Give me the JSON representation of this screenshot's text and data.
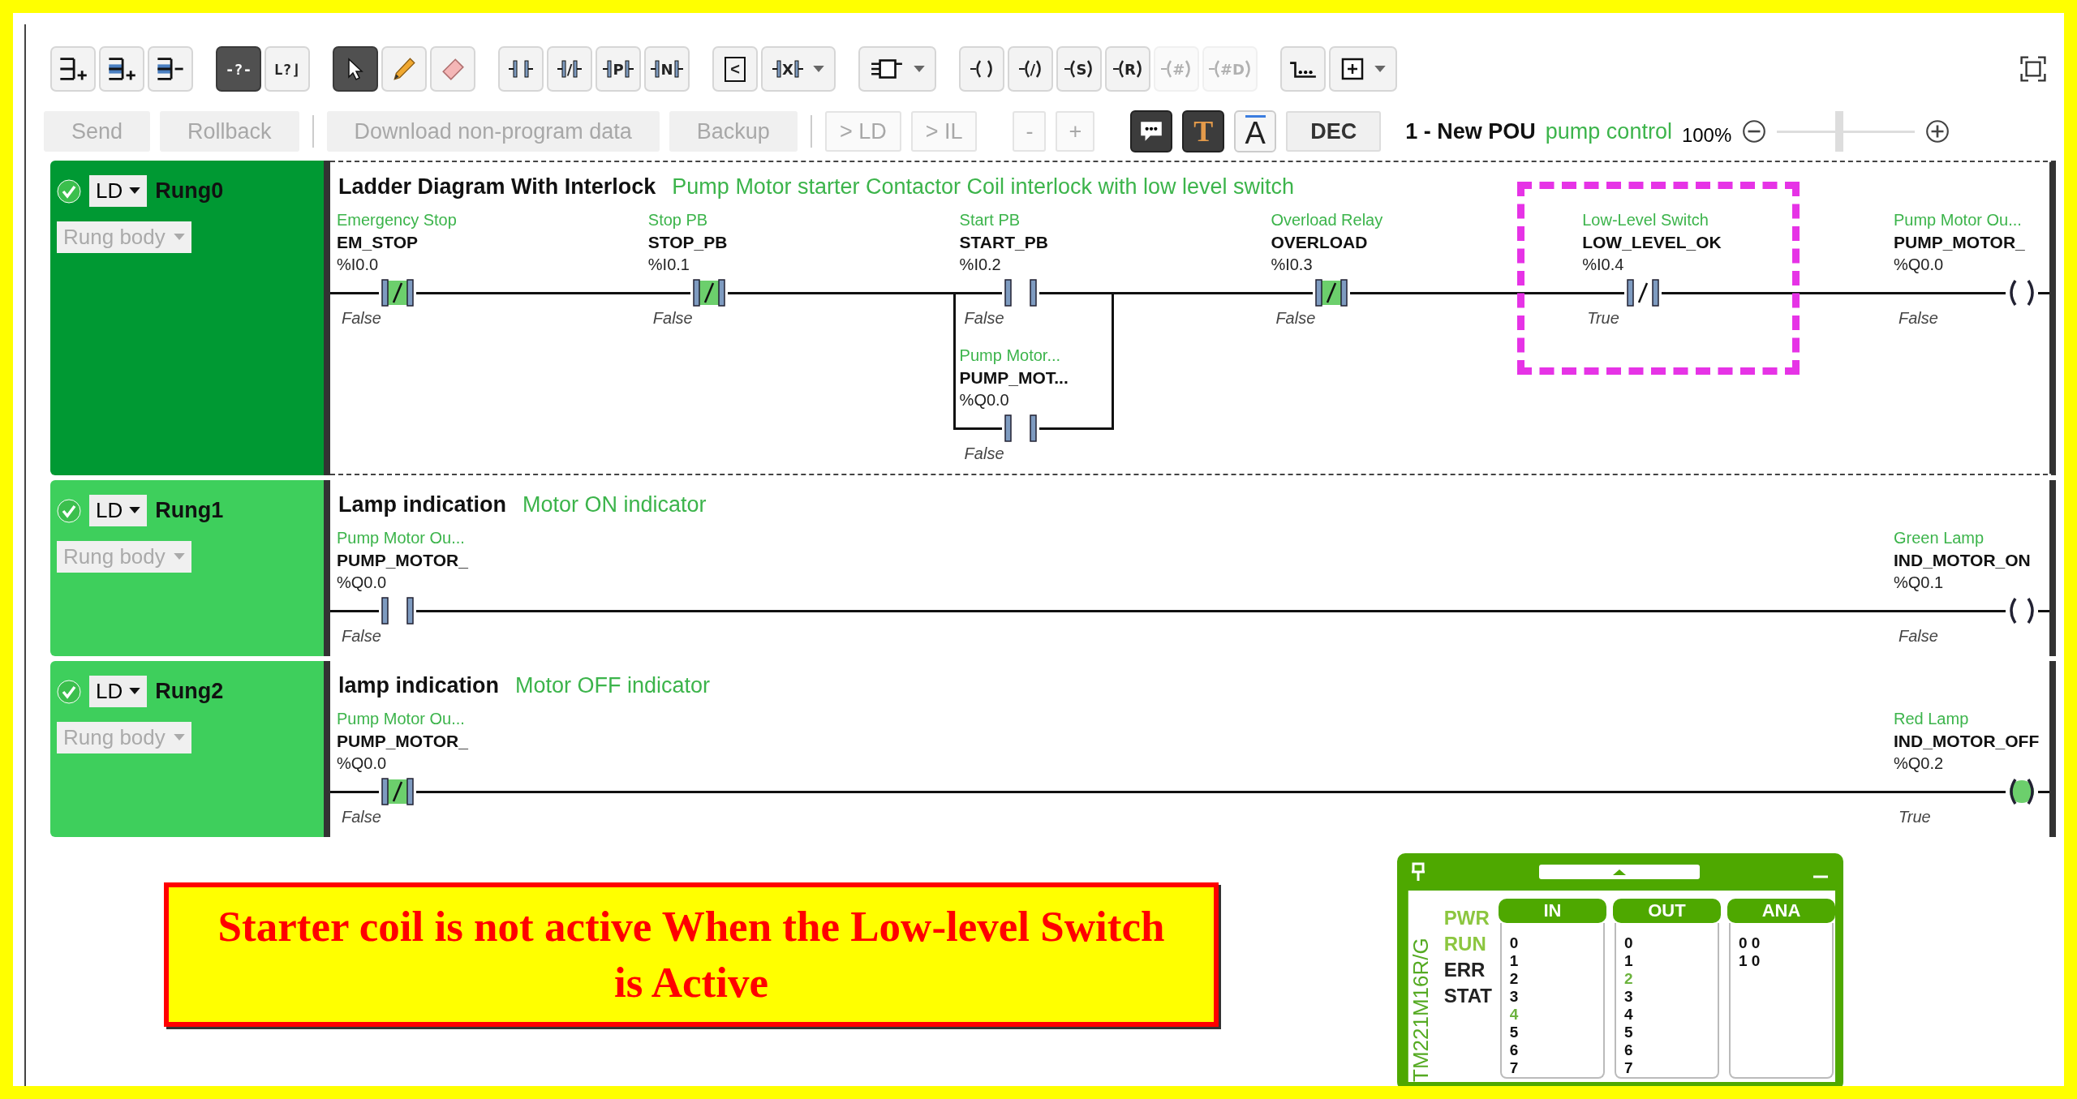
{
  "toolbar": [
    {
      "kind": "rung_add",
      "selected": false,
      "disabled": false,
      "dropdown": false
    },
    {
      "kind": "rung_add_blue",
      "selected": false,
      "disabled": false,
      "dropdown": false
    },
    {
      "kind": "rung_remove",
      "selected": false,
      "disabled": false,
      "dropdown": false
    },
    {
      "kind": "glyph",
      "glyph": "-?-",
      "selected": true,
      "disabled": false,
      "dropdown": false
    },
    {
      "kind": "glyph",
      "glyph": "L?⌋",
      "selected": false,
      "disabled": false,
      "dropdown": false
    },
    {
      "kind": "pointer",
      "selected": true,
      "disabled": false,
      "dropdown": false
    },
    {
      "kind": "pencil",
      "selected": false,
      "disabled": false,
      "dropdown": false
    },
    {
      "kind": "eraser",
      "selected": false,
      "disabled": false,
      "dropdown": false
    },
    {
      "kind": "contact",
      "selected": false,
      "disabled": false,
      "dropdown": false
    },
    {
      "kind": "contact",
      "glyph": "/",
      "selected": false,
      "disabled": false,
      "dropdown": false
    },
    {
      "kind": "contact",
      "glyph": "P",
      "selected": false,
      "disabled": false,
      "dropdown": false
    },
    {
      "kind": "contact",
      "glyph": "N",
      "selected": false,
      "disabled": false,
      "dropdown": false
    },
    {
      "kind": "compare",
      "glyph": "<",
      "selected": false,
      "disabled": false,
      "dropdown": false
    },
    {
      "kind": "contact",
      "glyph": "X",
      "selected": false,
      "disabled": false,
      "dropdown": true
    },
    {
      "kind": "block",
      "selected": false,
      "disabled": false,
      "dropdown": true
    },
    {
      "kind": "coil",
      "selected": false,
      "disabled": false,
      "dropdown": false
    },
    {
      "kind": "coil",
      "glyph": "/",
      "selected": false,
      "disabled": false,
      "dropdown": false
    },
    {
      "kind": "coil",
      "glyph": "S",
      "selected": false,
      "disabled": false,
      "dropdown": false
    },
    {
      "kind": "coil",
      "glyph": "R",
      "selected": false,
      "disabled": false,
      "dropdown": false
    },
    {
      "kind": "coil",
      "glyph": "#",
      "selected": false,
      "disabled": true,
      "dropdown": false
    },
    {
      "kind": "coil",
      "glyph": "#D",
      "selected": false,
      "disabled": true,
      "dropdown": false
    },
    {
      "kind": "dots",
      "selected": false,
      "disabled": false,
      "dropdown": false
    },
    {
      "kind": "add_box",
      "selected": false,
      "disabled": false,
      "dropdown": true
    }
  ],
  "actions": [
    {
      "label": "Send",
      "disabled": true
    },
    {
      "label": "Rollback",
      "disabled": true
    }
  ],
  "data_actions": [
    {
      "label": "Download non-program data",
      "disabled": true
    },
    {
      "label": "Backup",
      "disabled": true
    }
  ],
  "convert": [
    {
      "label": "> LD",
      "disabled": true
    },
    {
      "label": "> IL",
      "disabled": true
    }
  ],
  "zoom_steps": [
    {
      "label": "-",
      "disabled": true
    },
    {
      "label": "+",
      "disabled": true
    }
  ],
  "toggles": [
    {
      "kind": "comment",
      "selected": true
    },
    {
      "kind": "text",
      "glyph": "T",
      "selected": true
    },
    {
      "kind": "font",
      "glyph": "A",
      "selected": false
    }
  ],
  "base_button": {
    "label": "DEC"
  },
  "pou": {
    "name": "1 - New POU",
    "comment": "pump control"
  },
  "zoom": {
    "reading": "100%",
    "level": 0.45
  },
  "rungs": [
    {
      "name": "Rung0",
      "language": "LD",
      "valid": true,
      "selected": true,
      "body_select": "Rung body",
      "title": "Ladder Diagram With Interlock",
      "comment": "Pump Motor starter Contactor Coil interlock with low level switch",
      "contacts": [
        {
          "kind": "nc",
          "comment": "Emergency Stop",
          "symbol": "EM_STOP",
          "address": "%I0.0",
          "value": "False",
          "powered": true
        },
        {
          "kind": "nc",
          "comment": "Stop PB",
          "symbol": "STOP_PB",
          "address": "%I0.1",
          "value": "False",
          "powered": true
        },
        {
          "kind": "no",
          "comment": "Start PB",
          "symbol": "START_PB",
          "address": "%I0.2",
          "value": "False",
          "powered": false,
          "parallel": [
            {
              "kind": "no",
              "comment": "Pump Motor...",
              "symbol": "PUMP_MOT...",
              "address": "%Q0.0",
              "value": "False",
              "powered": false
            }
          ]
        },
        {
          "kind": "nc",
          "comment": "Overload Relay",
          "symbol": "OVERLOAD",
          "address": "%I0.3",
          "value": "False",
          "powered": true
        },
        {
          "kind": "nc",
          "comment": "Low-Level Switch",
          "symbol": "LOW_LEVEL_OK",
          "address": "%I0.4",
          "value": "True",
          "powered": false,
          "highlighted": true
        }
      ],
      "coil": {
        "comment": "Pump Motor Ou...",
        "symbol": "PUMP_MOTOR_",
        "address": "%Q0.0",
        "value": "False",
        "powered": false
      }
    },
    {
      "name": "Rung1",
      "language": "LD",
      "valid": true,
      "selected": false,
      "body_select": "Rung body",
      "title": "Lamp indication",
      "comment": "Motor ON indicator",
      "contacts": [
        {
          "kind": "no",
          "comment": "Pump Motor Ou...",
          "symbol": "PUMP_MOTOR_",
          "address": "%Q0.0",
          "value": "False",
          "powered": false
        }
      ],
      "coil": {
        "comment": "Green Lamp",
        "symbol": "IND_MOTOR_ON",
        "address": "%Q0.1",
        "value": "False",
        "powered": false
      }
    },
    {
      "name": "Rung2",
      "language": "LD",
      "valid": true,
      "selected": false,
      "body_select": "Rung body",
      "title": "lamp indication",
      "comment": "Motor OFF indicator",
      "contacts": [
        {
          "kind": "nc",
          "comment": "Pump Motor Ou...",
          "symbol": "PUMP_MOTOR_",
          "address": "%Q0.0",
          "value": "False",
          "powered": true
        }
      ],
      "coil": {
        "comment": "Red Lamp",
        "symbol": "IND_MOTOR_OFF",
        "address": "%Q0.2",
        "value": "True",
        "powered": true
      }
    }
  ],
  "annotation": {
    "text": "Starter coil is not active When the Low-level Switch is Active"
  },
  "simulator": {
    "model": "TM221M16R/G",
    "leds": [
      {
        "label": "PWR",
        "on": true
      },
      {
        "label": "RUN",
        "on": true
      },
      {
        "label": "ERR",
        "on": false
      },
      {
        "label": "STAT",
        "on": false
      }
    ],
    "io": [
      {
        "title": "IN",
        "channels": [
          {
            "label": "0",
            "on": false
          },
          {
            "label": "1",
            "on": false
          },
          {
            "label": "2",
            "on": false
          },
          {
            "label": "3",
            "on": false
          },
          {
            "label": "4",
            "on": true
          },
          {
            "label": "5",
            "on": false
          },
          {
            "label": "6",
            "on": false
          },
          {
            "label": "7",
            "on": false
          }
        ]
      },
      {
        "title": "OUT",
        "channels": [
          {
            "label": "0",
            "on": false
          },
          {
            "label": "1",
            "on": false
          },
          {
            "label": "2",
            "on": true
          },
          {
            "label": "3",
            "on": false
          },
          {
            "label": "4",
            "on": false
          },
          {
            "label": "5",
            "on": false
          },
          {
            "label": "6",
            "on": false
          },
          {
            "label": "7",
            "on": false
          }
        ]
      },
      {
        "title": "ANA",
        "channels": [
          {
            "label": "0 0",
            "on": false
          },
          {
            "label": "1 0",
            "on": false
          }
        ]
      }
    ]
  }
}
